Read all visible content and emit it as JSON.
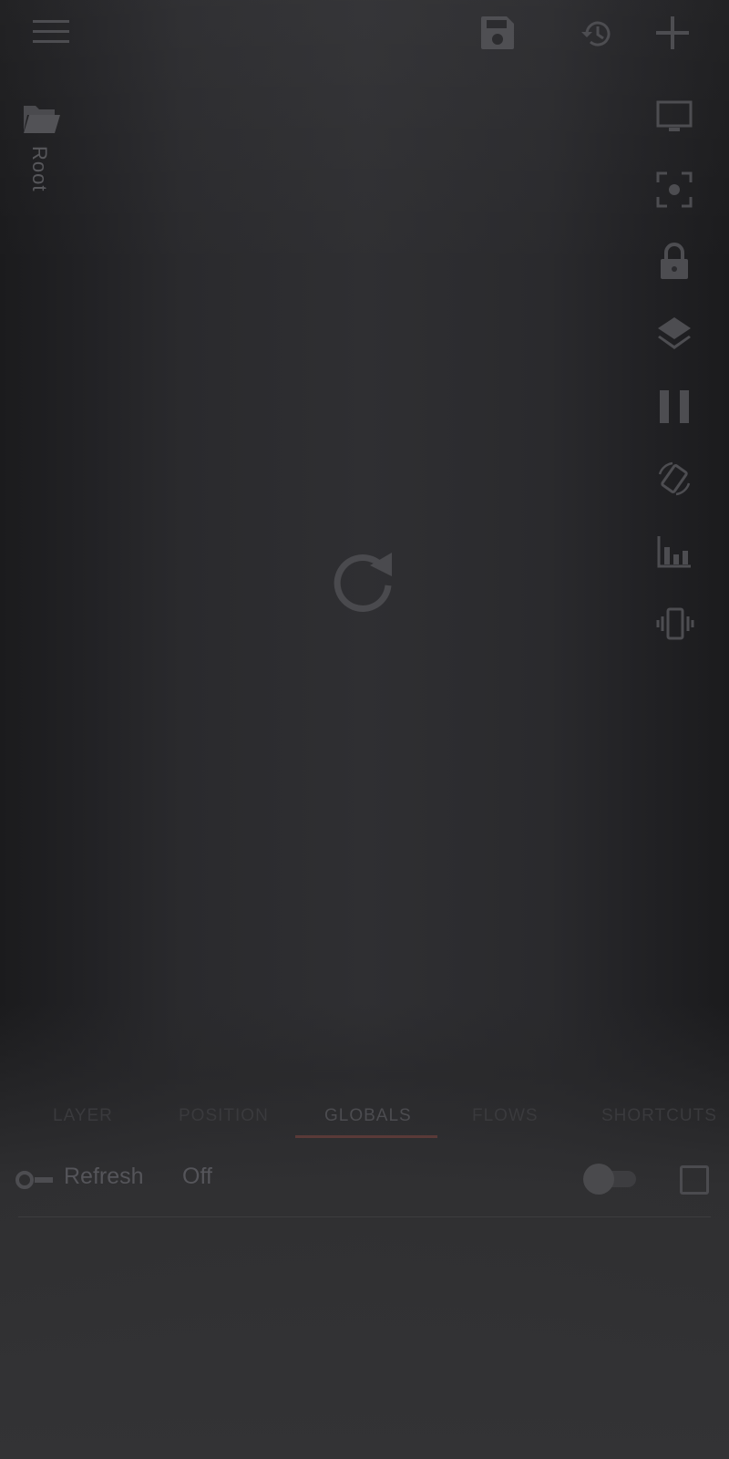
{
  "toolbar": {
    "menu_icon": "hamburger-menu-icon",
    "save_icon": "save-floppy-icon",
    "history_icon": "history-icon",
    "add_icon": "plus-icon"
  },
  "sidebar": {
    "folder_icon": "folder-icon",
    "root_label": "Root"
  },
  "right_tools": [
    "monitor-icon",
    "focus-frame-icon",
    "lock-icon",
    "layers-icon",
    "pause-icon",
    "rotate-screen-icon",
    "stats-chart-icon",
    "vibrate-icon"
  ],
  "center": {
    "refresh_icon": "refresh-icon"
  },
  "tabs": [
    {
      "label": "LAYER"
    },
    {
      "label": "POSITION"
    },
    {
      "label": "GLOBALS",
      "active": true
    },
    {
      "label": "FLOWS"
    },
    {
      "label": "SHORTCUTS"
    }
  ],
  "globals": {
    "refresh": {
      "icon": "toggle-variable-icon",
      "label": "Refresh",
      "value": "Off",
      "enabled": false,
      "checked": false
    }
  },
  "colors": {
    "accent": "#5a3a38",
    "icon": "#4d4d51"
  }
}
